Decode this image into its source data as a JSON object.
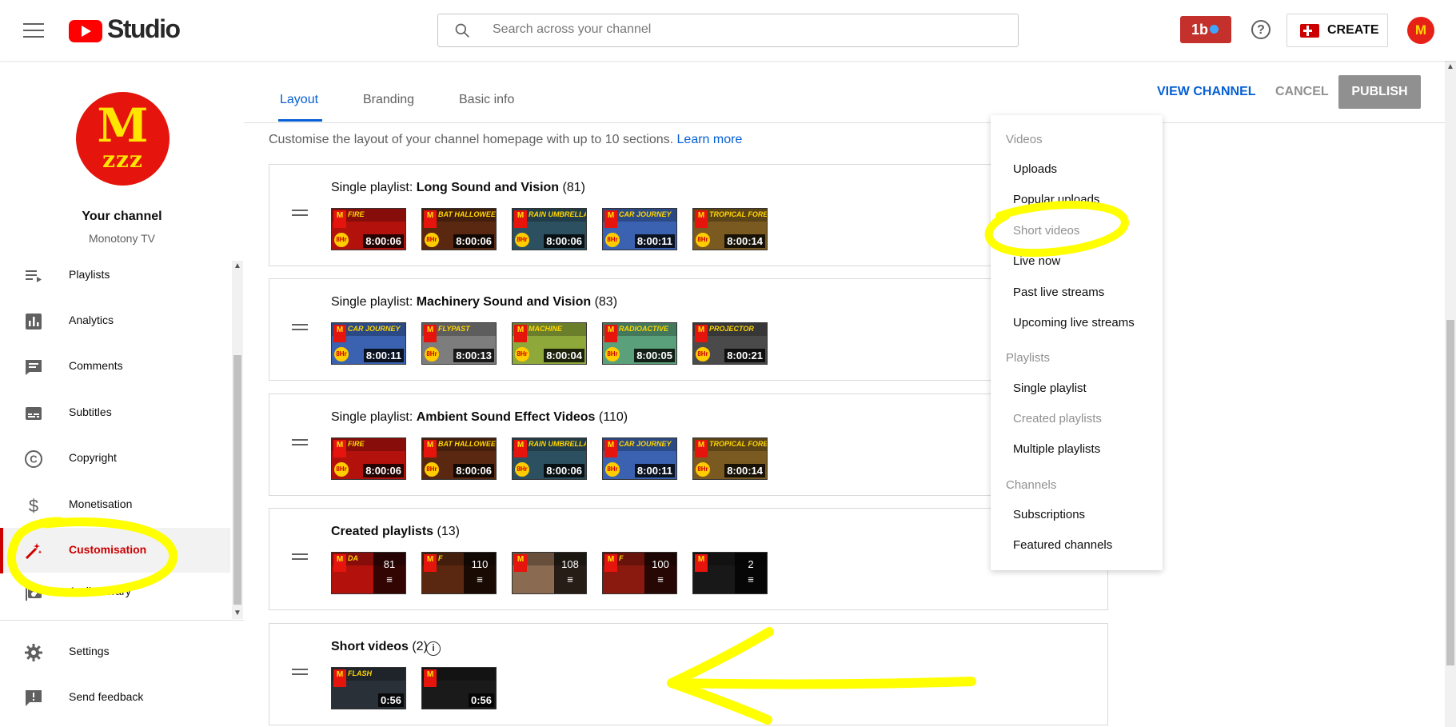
{
  "header": {
    "logo_text": "Studio",
    "search_placeholder": "Search across your channel",
    "badge_label": "1b",
    "help_label": "?",
    "create_label": "CREATE",
    "avatar_label": "M"
  },
  "channel": {
    "avatar_m": "M",
    "avatar_z": "zzz",
    "title": "Your channel",
    "name": "Monotony TV"
  },
  "sidebar": {
    "items": [
      {
        "label": "Playlists",
        "icon": "playlists-icon"
      },
      {
        "label": "Analytics",
        "icon": "analytics-icon"
      },
      {
        "label": "Comments",
        "icon": "comments-icon"
      },
      {
        "label": "Subtitles",
        "icon": "subtitles-icon"
      },
      {
        "label": "Copyright",
        "icon": "copyright-icon"
      },
      {
        "label": "Monetisation",
        "icon": "monetisation-icon"
      },
      {
        "label": "Customisation",
        "icon": "customisation-icon",
        "active": true
      },
      {
        "label": "Audio library",
        "icon": "audio-library-icon"
      }
    ],
    "footer": [
      {
        "label": "Settings",
        "icon": "gear-icon"
      },
      {
        "label": "Send feedback",
        "icon": "feedback-icon"
      }
    ]
  },
  "tabs": [
    {
      "label": "Layout",
      "active": true
    },
    {
      "label": "Branding"
    },
    {
      "label": "Basic info"
    }
  ],
  "actions": {
    "view_channel": "VIEW CHANNEL",
    "cancel": "CANCEL",
    "publish": "PUBLISH"
  },
  "intro": {
    "text": "Customise the layout of your channel homepage with up to 10 sections.",
    "link": "Learn more"
  },
  "sections": [
    {
      "prefix": "Single playlist: ",
      "name": "Long Sound and Vision",
      "count": " (81)",
      "thumbs": [
        {
          "title": "FIRE",
          "duration": "8:00:06",
          "color": "#b3120c"
        },
        {
          "title": "BAT HALLOWEEN",
          "duration": "8:00:06",
          "color": "#5a2810"
        },
        {
          "title": "RAIN UMBRELLA",
          "duration": "8:00:06",
          "color": "#2c5060"
        },
        {
          "title": "CAR JOURNEY",
          "duration": "8:00:11",
          "color": "#3a62b0"
        },
        {
          "title": "TROPICAL FOREST",
          "duration": "8:00:14",
          "color": "#7a5a20"
        }
      ]
    },
    {
      "prefix": "Single playlist: ",
      "name": "Machinery Sound and Vision",
      "count": " (83)",
      "thumbs": [
        {
          "title": "CAR JOURNEY",
          "duration": "8:00:11",
          "color": "#3a62b0"
        },
        {
          "title": "FLYPAST",
          "duration": "8:00:13",
          "color": "#7d7d7d"
        },
        {
          "title": "MACHINE",
          "duration": "8:00:04",
          "color": "#8ea83a"
        },
        {
          "title": "RADIOACTIVE",
          "duration": "8:00:05",
          "color": "#5aa07a"
        },
        {
          "title": "PROJECTOR",
          "duration": "8:00:21",
          "color": "#4a4a4a"
        }
      ]
    },
    {
      "prefix": "Single playlist: ",
      "name": "Ambient Sound Effect Videos",
      "count": " (110)",
      "thumbs": [
        {
          "title": "FIRE",
          "duration": "8:00:06",
          "color": "#b3120c"
        },
        {
          "title": "BAT HALLOWEEN",
          "duration": "8:00:06",
          "color": "#5a2810"
        },
        {
          "title": "RAIN UMBRELLA",
          "duration": "8:00:06",
          "color": "#2c5060"
        },
        {
          "title": "CAR JOURNEY",
          "duration": "8:00:11",
          "color": "#3a62b0"
        },
        {
          "title": "TROPICAL FOREST",
          "duration": "8:00:14",
          "color": "#7a5a20"
        }
      ]
    },
    {
      "prefix": "",
      "name": "Created playlists",
      "count": " (13)",
      "thumbs": [
        {
          "title": "DA",
          "count": "81",
          "color": "#b3120c"
        },
        {
          "title": "F",
          "count": "110",
          "color": "#5a2810"
        },
        {
          "title": "",
          "count": "108",
          "color": "#8a6a50"
        },
        {
          "title": "F",
          "count": "100",
          "color": "#8a1a10"
        },
        {
          "title": "",
          "count": "2",
          "color": "#181818"
        }
      ]
    },
    {
      "prefix": "",
      "name": "Short videos",
      "count": " (2)",
      "info": true,
      "thumbs": [
        {
          "title": "FLASH",
          "duration": "0:56",
          "color": "#2a3038"
        },
        {
          "title": "",
          "duration": "0:56",
          "color": "#1a1a1a"
        }
      ]
    }
  ],
  "menu": {
    "groups": [
      {
        "heading": "Videos",
        "items": [
          {
            "label": "Uploads"
          },
          {
            "label": "Popular uploads"
          },
          {
            "label": "Short videos",
            "disabled": true
          },
          {
            "label": "Live now"
          },
          {
            "label": "Past live streams"
          },
          {
            "label": "Upcoming live streams"
          }
        ]
      },
      {
        "heading": "Playlists",
        "items": [
          {
            "label": "Single playlist"
          },
          {
            "label": "Created playlists",
            "disabled": true
          },
          {
            "label": "Multiple playlists"
          }
        ]
      },
      {
        "heading": "Channels",
        "items": [
          {
            "label": "Subscriptions"
          },
          {
            "label": "Featured channels"
          }
        ]
      }
    ]
  },
  "colors": {
    "accent_blue": "#065fd4",
    "brand_red": "#ff0000",
    "active_red": "#cc0000",
    "highlight_yellow": "#ffff00"
  }
}
